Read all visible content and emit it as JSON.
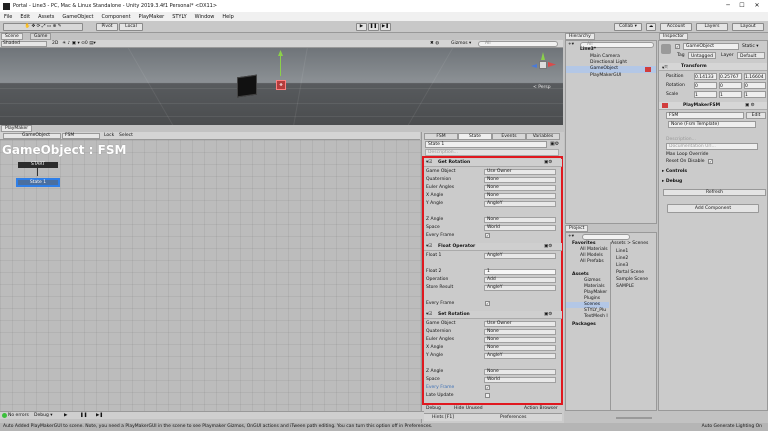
{
  "window": {
    "title": "Portal - Line3 - PC, Mac & Linux Standalone - Unity 2019.3.4f1 Personal* <DX11>"
  },
  "menu": [
    "File",
    "Edit",
    "Assets",
    "GameObject",
    "Component",
    "PlayMaker",
    "STYLY",
    "Window",
    "Help"
  ],
  "toolbar": {
    "pivot": "Pivot",
    "local": "Local",
    "collab": "Collab ▾",
    "account": "Account",
    "layers": "Layers",
    "layout": "Layout"
  },
  "scene": {
    "tabs": [
      "Scene",
      "Game"
    ],
    "shading": "Shaded",
    "mode2d": "2D",
    "gizmos": "Gizmos ▾",
    "search": "All",
    "persp": "< Persp"
  },
  "playmaker": {
    "tab": "PlayMaker",
    "object": "GameObject",
    "fsm": "FSM",
    "lock": "Lock",
    "select": "Select",
    "canvas_title": "GameObject : FSM",
    "start": "START",
    "state_node": "State 1"
  },
  "fsm_panel": {
    "tabs": [
      "FSM",
      "State",
      "Events",
      "Variables"
    ],
    "state_name": "State 1",
    "description": "Description...",
    "actions": [
      {
        "title": "Get Rotation",
        "fields": [
          {
            "label": "Game Object",
            "value": "Use Owner"
          },
          {
            "label": "Quaternion",
            "value": "None"
          },
          {
            "label": "Euler Angles",
            "value": "None"
          },
          {
            "label": "X Angle",
            "value": "None"
          },
          {
            "label": "Y Angle",
            "value": "AngleY"
          },
          {
            "label": "Z Angle",
            "value": "None"
          },
          {
            "label": "Space",
            "value": "World"
          },
          {
            "label": "Every Frame",
            "value": "✓"
          }
        ]
      },
      {
        "title": "Float Operator",
        "fields": [
          {
            "label": "Float 1",
            "value": "AngleY"
          },
          {
            "label": "Float 2",
            "value": "1"
          },
          {
            "label": "Operation",
            "value": "Add"
          },
          {
            "label": "Store Result",
            "value": "AngleY"
          },
          {
            "label": "Every Frame",
            "value": "✓"
          }
        ]
      },
      {
        "title": "Set Rotation",
        "fields": [
          {
            "label": "Game Object",
            "value": "Use Owner"
          },
          {
            "label": "Quaternion",
            "value": "None"
          },
          {
            "label": "Euler Angles",
            "value": "None"
          },
          {
            "label": "X Angle",
            "value": "None"
          },
          {
            "label": "Y Angle",
            "value": "AngleY"
          },
          {
            "label": "Z Angle",
            "value": "None"
          },
          {
            "label": "Space",
            "value": "World"
          },
          {
            "label": "Every Frame",
            "value": "✓"
          },
          {
            "label": "Late Update",
            "value": ""
          }
        ]
      }
    ],
    "debug": "Debug",
    "hide_unused": "Hide Unused",
    "action_browser": "Action Browser",
    "hints": "Hints [F1]",
    "preferences": "Preferences"
  },
  "hierarchy": {
    "tab": "Hierarchy",
    "search": "All",
    "items": [
      "Line3*",
      "Main Camera",
      "Directional Light",
      "GameObject",
      "PlayMakerGUI"
    ]
  },
  "project": {
    "tab": "Project",
    "favorites": [
      "Favorites",
      "All Materials",
      "All Models",
      "All Prefabs"
    ],
    "assets_tree": [
      "Assets",
      "Gizmos",
      "Materials",
      "PlayMaker",
      "Plugins",
      "Scenes",
      "STYLY_Plu",
      "TextMesh I",
      "Packages"
    ],
    "breadcrumb": "Assets > Scenes",
    "files": [
      "Line1",
      "Line2",
      "Line3",
      "Portal Scene",
      "Sample Scene",
      "SAMPLE"
    ]
  },
  "inspector": {
    "tab": "Inspector",
    "object_name": "GameObject",
    "static": "Static ▾",
    "tag_label": "Tag",
    "tag": "Untagged",
    "layer_label": "Layer",
    "layer": "Default",
    "transform_title": "Transform",
    "position": {
      "label": "Position",
      "x": "0.14133",
      "y": "0.25767",
      "z": "1.16604"
    },
    "rotation": {
      "label": "Rotation",
      "x": "0",
      "y": "0",
      "z": "0"
    },
    "scale": {
      "label": "Scale",
      "x": "1",
      "y": "1",
      "z": "1"
    },
    "pm_title": "PlayMakerFSM",
    "fsm_name": "FSM",
    "edit": "Edit",
    "template": "None (Fsm Template)",
    "description": "Description...",
    "doc_url": "Documentation Url...",
    "max_loop": "Max Loop Override",
    "reset": "Reset On Disable",
    "controls": "Controls",
    "debug": "Debug",
    "refresh": "Refresh",
    "add_component": "Add Component"
  },
  "statusbar": {
    "errors": "No errors",
    "debug": "Debug ▾",
    "message": "Auto Added PlayMakerGUI to scene. Note, you need a PlayMakerGUI in the scene to see Playmaker Gizmos, OnGUI actions and iTween path editing. You can turn this option off in Preferences.",
    "right": "Auto Generate Lighting On"
  },
  "colors": {
    "highlight": "#e0181f",
    "selection": "#3d7bd9",
    "state_node": "#4a6fa0"
  }
}
